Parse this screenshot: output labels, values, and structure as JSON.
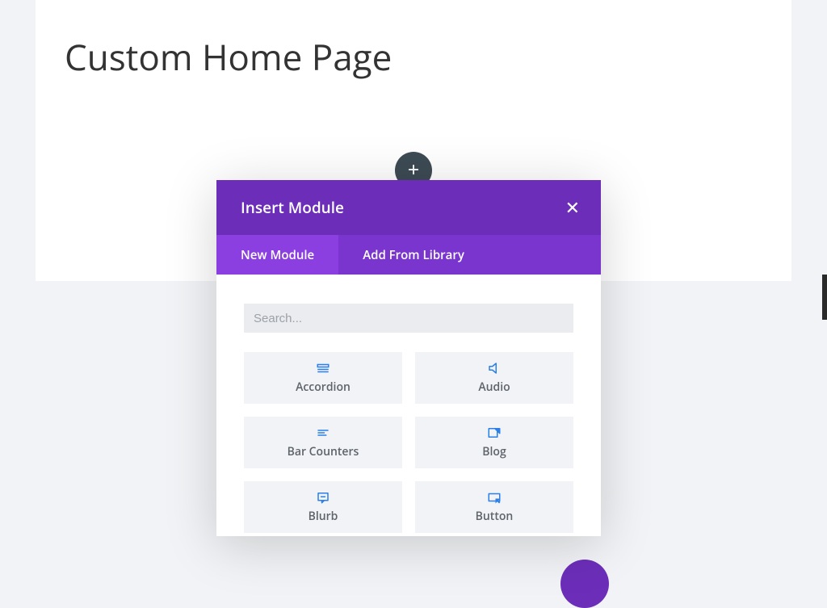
{
  "page": {
    "title": "Custom Home Page"
  },
  "modal": {
    "title": "Insert Module",
    "tabs": {
      "new": "New Module",
      "library": "Add From Library"
    },
    "search_placeholder": "Search...",
    "search_value": "",
    "modules": [
      {
        "label": "Accordion",
        "icon": "accordion"
      },
      {
        "label": "Audio",
        "icon": "audio"
      },
      {
        "label": "Bar Counters",
        "icon": "bar-counters"
      },
      {
        "label": "Blog",
        "icon": "blog"
      },
      {
        "label": "Blurb",
        "icon": "blurb"
      },
      {
        "label": "Button",
        "icon": "button"
      }
    ]
  },
  "colors": {
    "brand_purple": "#6c2eb9",
    "brand_purple_light": "#8b3fe0",
    "brand_purple_mid": "#7a35cf",
    "icon_blue": "#2a80e6",
    "tile_bg": "#f1f3f6"
  }
}
